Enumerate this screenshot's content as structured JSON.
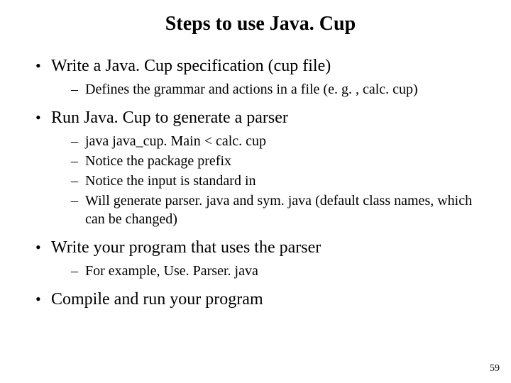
{
  "title": "Steps to use Java. Cup",
  "bullets": [
    {
      "text": "Write a Java. Cup specification (cup file)",
      "sub": [
        "Defines the grammar and actions in a file (e. g. , calc. cup)"
      ]
    },
    {
      "text": "Run Java. Cup to generate a parser",
      "sub": [
        "java java_cup. Main < calc. cup",
        "Notice the package prefix",
        "Notice the input is standard in",
        "Will generate parser. java and sym. java (default class names, which can be changed)"
      ]
    },
    {
      "text": "Write your program that uses the parser",
      "sub": [
        "For example, Use. Parser. java"
      ]
    },
    {
      "text": "Compile and run your program",
      "sub": []
    }
  ],
  "page_number": "59"
}
